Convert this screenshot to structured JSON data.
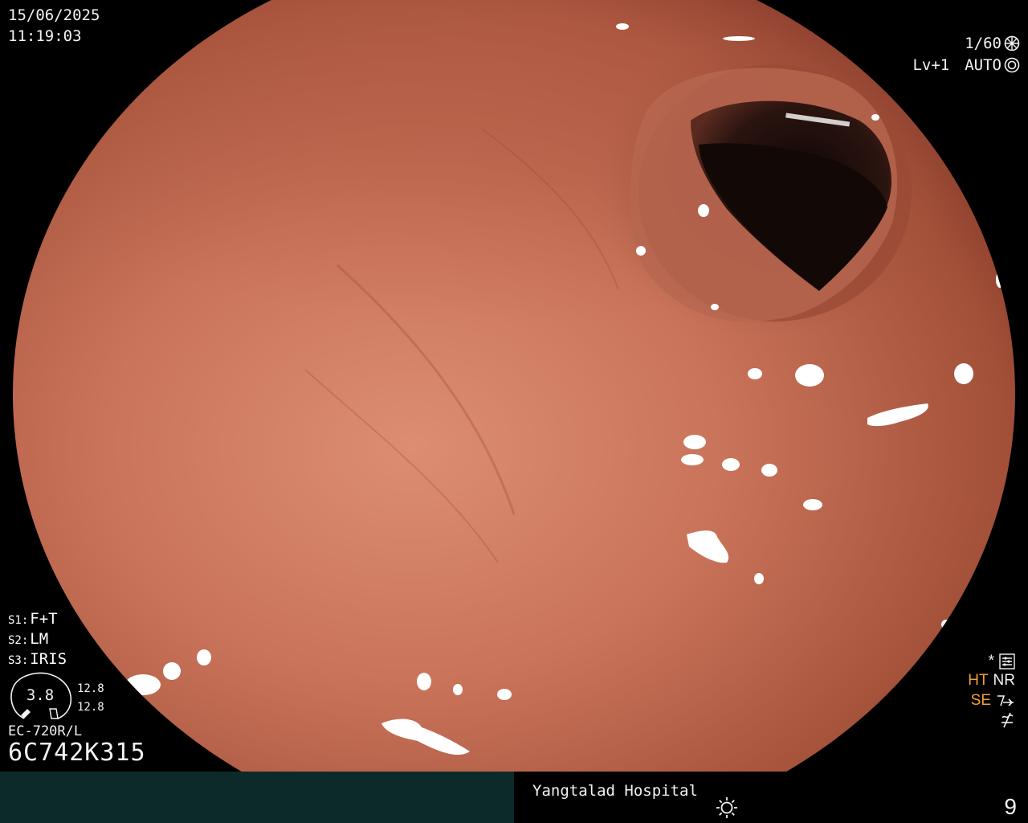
{
  "overlay": {
    "date": "15/06/2025",
    "time": "11:19:03",
    "shutter": "1/60",
    "level": "Lv+1",
    "iris_mode": "AUTO",
    "s1": {
      "key": "S1:",
      "value": "F+T"
    },
    "s2": {
      "key": "S2:",
      "value": "LM"
    },
    "s3": {
      "key": "S3:",
      "value": "IRIS"
    },
    "gauge_value": "3.8",
    "gauge_upper": "12.8",
    "gauge_lower": "12.8",
    "scope_model": "EC-720R/L",
    "scope_serial": "6C742K315",
    "star": "*",
    "ht": "HT",
    "nr": "NR",
    "se": "SE"
  },
  "status_bar": {
    "hospital": "Yangtalad Hospital",
    "counter": "9"
  },
  "icons": {
    "shutter": "shutter-wheel-icon",
    "iris": "iris-ring-icon",
    "settings": "settings-panel-icon",
    "se": "structure-enhance-icon",
    "flash": "flash-off-icon",
    "sun": "light-sun-icon"
  },
  "colors": {
    "mucosa": "#c46a4e",
    "lumen": "#1a0c0a",
    "status_bar": "#0c2a2a",
    "accent_orange": "#f0a030"
  }
}
